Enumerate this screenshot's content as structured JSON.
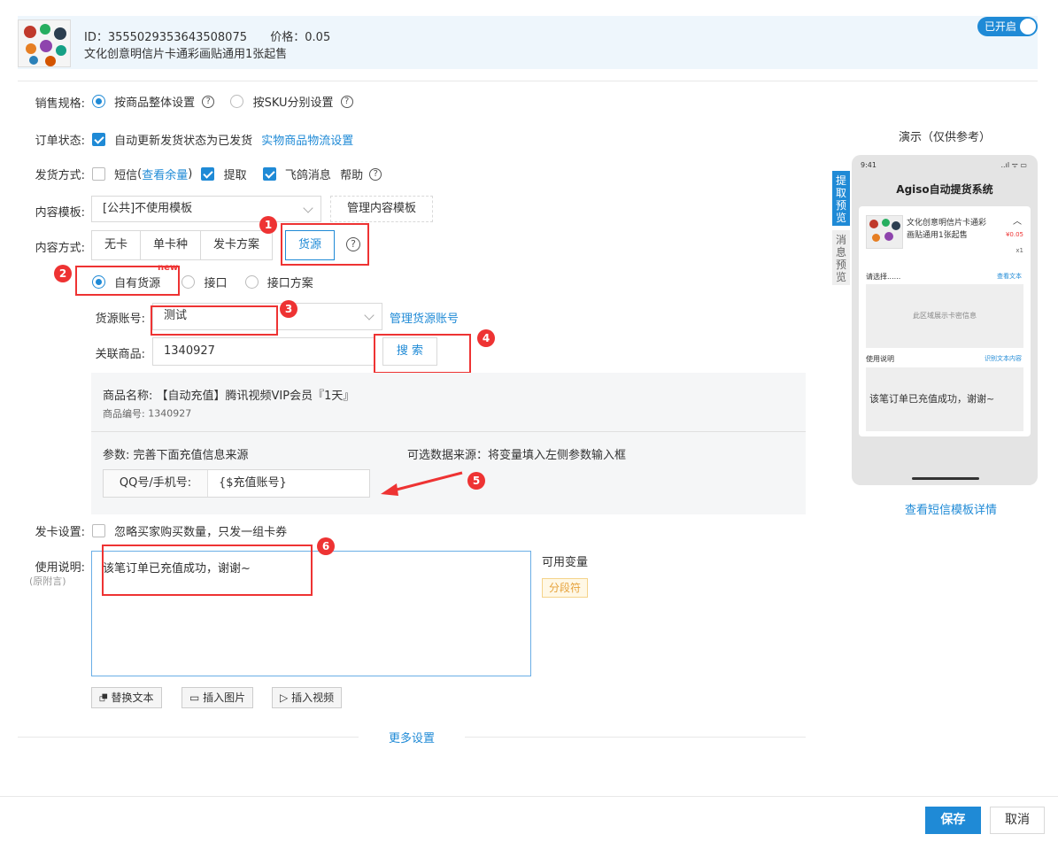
{
  "header": {
    "id_label": "ID：3555029353643508075",
    "price_label": "价格：0.05",
    "product_title": "文化创意明信片卡通彩画贴通用1张起售",
    "toggle_label": "已开启"
  },
  "form": {
    "sales_spec": {
      "label": "销售规格:",
      "option1": "按商品整体设置",
      "option2": "按SKU分别设置",
      "selected": "按商品整体设置"
    },
    "order_status": {
      "label": "订单状态:",
      "checkbox_label": "自动更新发货状态为已发货",
      "link": "实物商品物流设置",
      "checked": true
    },
    "delivery": {
      "label": "发货方式:",
      "sms": "短信",
      "sms_paren_open": "(",
      "sms_link": "查看余量",
      "sms_paren_close": ")",
      "pickup": "提取",
      "feige": "飞鸽消息",
      "help": "帮助",
      "sms_checked": false,
      "pickup_checked": true,
      "feige_checked": true
    },
    "template": {
      "label": "内容模板:",
      "value": "[公共]不使用模板",
      "manage_button": "管理内容模板"
    },
    "content_mode": {
      "label": "内容方式:",
      "tabs": [
        "无卡",
        "单卡种",
        "发卡方案",
        "货源"
      ],
      "active": "货源"
    },
    "source_type": {
      "option1": "自有货源",
      "new_badge": "new",
      "option2": "接口",
      "option3": "接口方案",
      "selected": "自有货源"
    },
    "source_account": {
      "label": "货源账号:",
      "value": "测试",
      "manage_link": "管理货源账号"
    },
    "linked_product": {
      "label": "关联商品:",
      "value": "1340927",
      "search_button": "搜 索"
    },
    "product_info": {
      "name_label": "商品名称:",
      "name_value": "【自动充值】腾讯视频VIP会员『1天』",
      "code_label": "商品编号:",
      "code_value": "1340927",
      "params_label": "参数:",
      "params_value": "完善下面充值信息来源",
      "optional_source": "可选数据来源：将变量填入左侧参数输入框",
      "param_field_label": "QQ号/手机号:",
      "param_field_value": "{$充值账号}"
    },
    "card_setting": {
      "label": "发卡设置:",
      "checkbox_label": "忽略买家购买数量，只发一组卡券",
      "checked": false
    },
    "usage": {
      "label": "使用说明:",
      "sub_label": "(原附言)",
      "text": "该笔订单已充值成功，谢谢~",
      "variables_label": "可用变量",
      "separator_tag": "分段符"
    },
    "toolbar": {
      "replace_text": "替换文本",
      "insert_image": "插入图片",
      "insert_video": "插入视频"
    },
    "more_settings": "更多设置"
  },
  "preview": {
    "title": "演示（仅供参考）",
    "tab_extract": "提取预览",
    "tab_message": "消息预览",
    "phone_time": "9:41",
    "phone_signal": "..ıl ᯤ ▭",
    "app_title": "Agiso自动提货系统",
    "product_name": "文化创意明信片卡通彩画贴通用1张起售",
    "price": "¥0.05",
    "qty": "x1",
    "choose": "请选择......",
    "view_text": "查看文本",
    "card_area": "此区域展示卡密信息",
    "usage_label": "使用说明",
    "recognize": "识别文本内容",
    "usage_text": "该笔订单已充值成功，谢谢~",
    "sms_detail_link": "查看短信模板详情"
  },
  "annotations": [
    "1",
    "2",
    "3",
    "4",
    "5",
    "6"
  ],
  "footer": {
    "save": "保存",
    "cancel": "取消"
  },
  "colors": {
    "accent": "#1f8ad6",
    "annotation_red": "#e33333",
    "header_bg": "#eef6fc"
  }
}
